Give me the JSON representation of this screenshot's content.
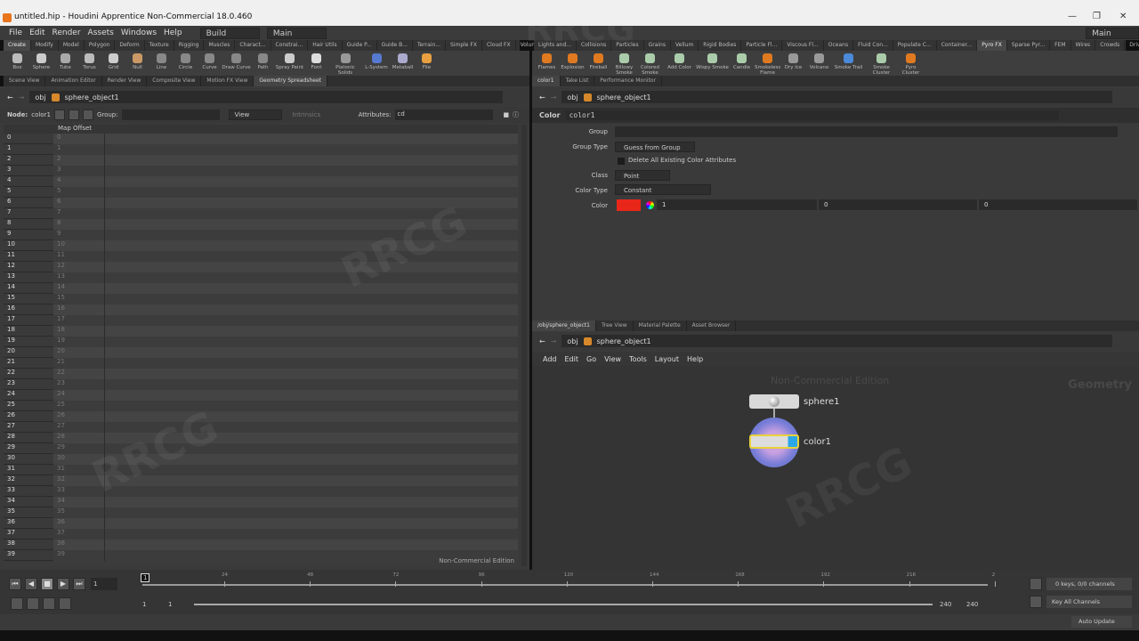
{
  "window": {
    "title": "untitled.hip - Houdini Apprentice Non-Commercial 18.0.460"
  },
  "menu": [
    "File",
    "Edit",
    "Render",
    "Assets",
    "Windows",
    "Help"
  ],
  "desktop_left": "Build",
  "desktop_mid": "Main",
  "desktop_right": "Main",
  "shelf_tabs_left": [
    "Create",
    "Modify",
    "Model",
    "Polygon",
    "Deform",
    "Texture",
    "Rigging",
    "Muscles",
    "Charact...",
    "Constrai...",
    "Hair Utils",
    "Guide P...",
    "Guide B...",
    "Terrain...",
    "Simple FX",
    "Cloud FX",
    "Volume"
  ],
  "shelf_tools_left": [
    "Box",
    "Sphere",
    "Tube",
    "Torus",
    "Grid",
    "Null",
    "Line",
    "Circle",
    "Curve",
    "Draw Curve",
    "Path",
    "Spray Paint",
    "Font",
    "Platonic Solids",
    "L-System",
    "Metaball",
    "File"
  ],
  "shelf_tabs_right": [
    "Lights and...",
    "Collisions",
    "Particles",
    "Grains",
    "Vellum",
    "Rigid Bodies",
    "Particle Fl...",
    "Viscous Fl...",
    "Oceans",
    "Fluid Con...",
    "Populate C...",
    "Container...",
    "Pyro FX",
    "Sparse Pyr...",
    "FEM",
    "Wires",
    "Crowds",
    "Drive Sim..."
  ],
  "shelf_tools_right": [
    "Flames",
    "Explosion",
    "Fireball",
    "Billowy Smoke",
    "Colored Smoke",
    "Add Color",
    "Wispy Smoke",
    "Candle",
    "Smokeless Flame",
    "Dry Ice",
    "Volcano",
    "Smoke Trail",
    "Smoke Cluster",
    "Pyro Cluster"
  ],
  "pane_tabs_left": [
    "Scene View",
    "Animation Editor",
    "Render View",
    "Composite View",
    "Motion FX View",
    "Geometry Spreadsheet"
  ],
  "pane_tabs_right": [
    "color1",
    "Take List",
    "Performance Monitor"
  ],
  "pane_tabs_net": [
    "/obj/sphere_object1",
    "Tree View",
    "Material Palette",
    "Asset Browser"
  ],
  "path": {
    "root": "obj",
    "object": "sphere_object1"
  },
  "spreadsheet": {
    "node_label": "Node:",
    "node": "color1",
    "group_label": "Group:",
    "view": "View",
    "intrinsics": "Intrinsics",
    "attributes_label": "Attributes:",
    "attributes": "cd",
    "column": "Map Offset",
    "rows": [
      "0",
      "1",
      "2",
      "3",
      "4",
      "5",
      "6",
      "7",
      "8",
      "9",
      "10",
      "11",
      "12",
      "13",
      "14",
      "15",
      "16",
      "17",
      "18",
      "19",
      "20",
      "21",
      "22",
      "23",
      "24",
      "25",
      "26",
      "27",
      "28",
      "29",
      "30",
      "31",
      "32",
      "33",
      "34",
      "35",
      "36",
      "37",
      "38",
      "39"
    ],
    "footer": "Non-Commercial Edition"
  },
  "params": {
    "type": "Color",
    "name": "color1",
    "group_label": "Group",
    "group_type_label": "Group Type",
    "group_type": "Guess from Group",
    "delete_label": "Delete All Existing Color Attributes",
    "class_label": "Class",
    "class": "Point",
    "color_type_label": "Color Type",
    "color_type": "Constant",
    "color_label": "Color",
    "color_values": [
      "1",
      "0",
      "0"
    ],
    "swatch": "#e8261a"
  },
  "network": {
    "menu": [
      "Add",
      "Edit",
      "Go",
      "View",
      "Tools",
      "Layout",
      "Help"
    ],
    "watermark": "Non-Commercial Edition",
    "context": "Geometry",
    "nodes": [
      "sphere1",
      "color1"
    ]
  },
  "timeline": {
    "frame": "1",
    "ticks": [
      "24",
      "48",
      "72",
      "96",
      "120",
      "144",
      "168",
      "192",
      "216",
      "2"
    ],
    "start": "1",
    "start2": "1",
    "end": "240",
    "end2": "240",
    "keys": "0 keys, 0/0 channels",
    "key_mode": "Key All Channels",
    "update": "Auto Update",
    "current": "1"
  }
}
